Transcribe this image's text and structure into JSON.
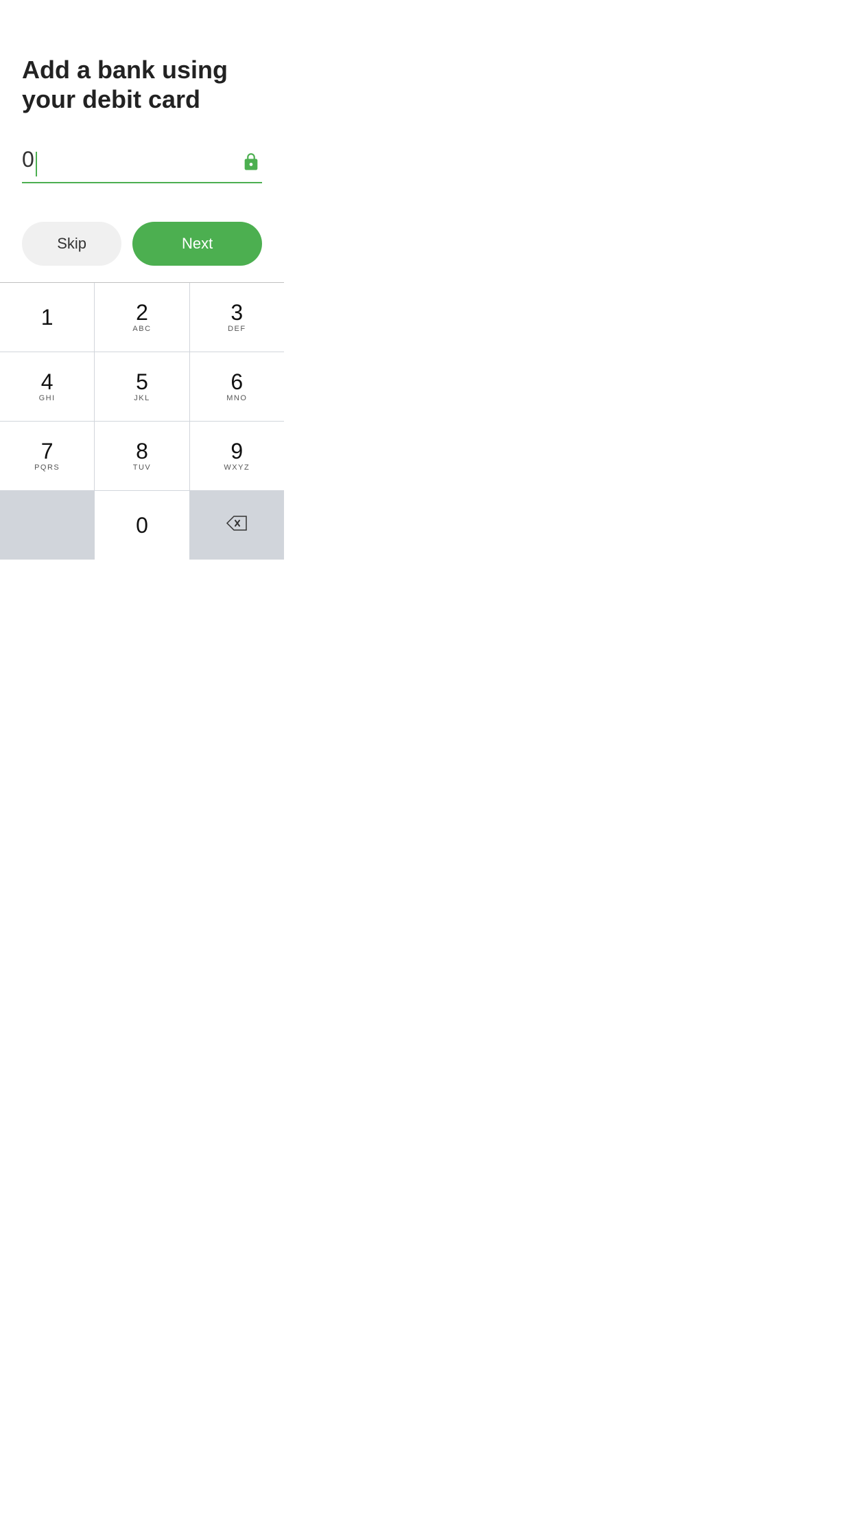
{
  "page": {
    "title": "Add a bank using your debit card",
    "input_value": "0",
    "lock_icon": "lock-icon",
    "accent_color": "#4CAF50"
  },
  "buttons": {
    "skip_label": "Skip",
    "next_label": "Next"
  },
  "numpad": {
    "rows": [
      [
        {
          "number": "1",
          "letters": ""
        },
        {
          "number": "2",
          "letters": "ABC"
        },
        {
          "number": "3",
          "letters": "DEF"
        }
      ],
      [
        {
          "number": "4",
          "letters": "GHI"
        },
        {
          "number": "5",
          "letters": "JKL"
        },
        {
          "number": "6",
          "letters": "MNO"
        }
      ],
      [
        {
          "number": "7",
          "letters": "PQRS"
        },
        {
          "number": "8",
          "letters": "TUV"
        },
        {
          "number": "9",
          "letters": "WXYZ"
        }
      ],
      [
        {
          "number": "",
          "letters": "",
          "type": "empty"
        },
        {
          "number": "0",
          "letters": ""
        },
        {
          "number": "",
          "letters": "",
          "type": "delete"
        }
      ]
    ]
  }
}
